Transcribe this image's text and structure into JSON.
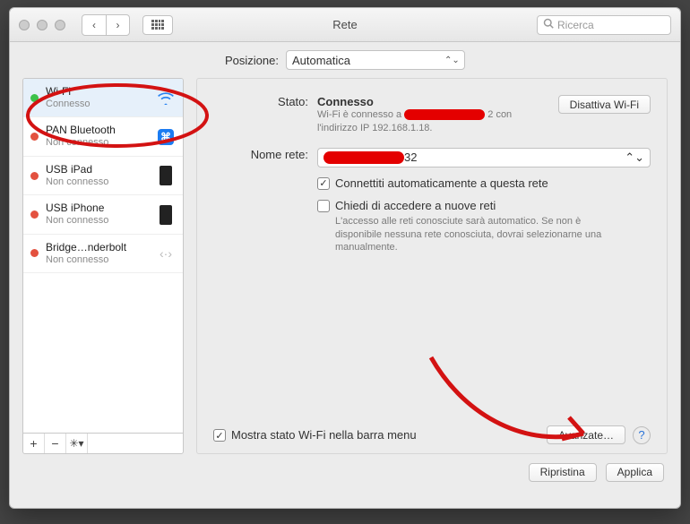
{
  "window": {
    "title": "Rete",
    "search_placeholder": "Ricerca"
  },
  "location": {
    "label": "Posizione:",
    "value": "Automatica"
  },
  "sidebar": {
    "items": [
      {
        "name": "Wi-Fi",
        "sub": "Connesso",
        "status": "green",
        "icon": "wifi"
      },
      {
        "name": "PAN Bluetooth",
        "sub": "Non connesso",
        "status": "red",
        "icon": "bluetooth"
      },
      {
        "name": "USB iPad",
        "sub": "Non connesso",
        "status": "red",
        "icon": "device"
      },
      {
        "name": "USB iPhone",
        "sub": "Non connesso",
        "status": "red",
        "icon": "device"
      },
      {
        "name": "Bridge…nderbolt",
        "sub": "Non connesso",
        "status": "red",
        "icon": "bridge"
      }
    ]
  },
  "detail": {
    "status_label": "Stato:",
    "status_value": "Connesso",
    "turn_off_label": "Disattiva Wi-Fi",
    "status_desc_prefix": "Wi-Fi è connesso a ",
    "status_desc_suffix": "2 con l'indirizzo IP 192.168.1.18.",
    "network_label": "Nome rete:",
    "network_value_suffix": "32",
    "auto_join_label": "Connettiti automaticamente a questa rete",
    "ask_join_label": "Chiedi di accedere a nuove reti",
    "ask_join_desc": "L'accesso alle reti conosciute sarà automatico. Se non è disponibile nessuna rete conosciuta, dovrai selezionarne una manualmente.",
    "show_status_label": "Mostra stato Wi-Fi nella barra menu",
    "advanced_label": "Avanzate…"
  },
  "buttons": {
    "revert": "Ripristina",
    "apply": "Applica"
  }
}
